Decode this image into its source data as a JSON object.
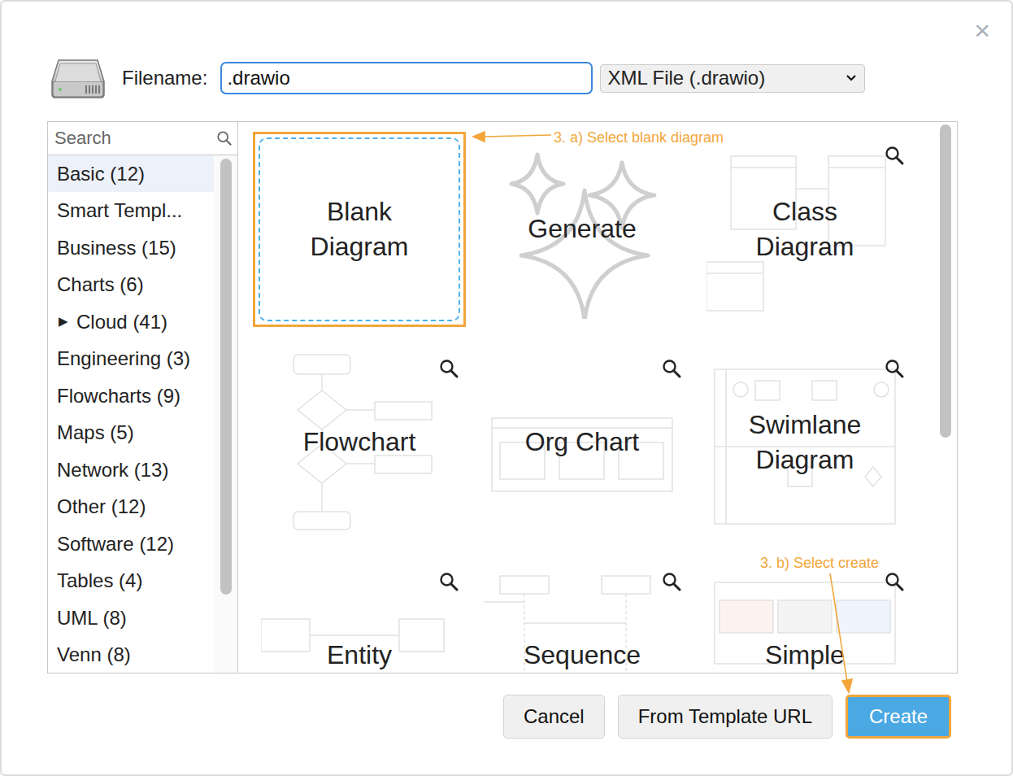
{
  "dialog": {
    "close": "×"
  },
  "filename": {
    "label": "Filename:",
    "value": ".drawio"
  },
  "format": {
    "value": "XML File (.drawio)"
  },
  "search": {
    "placeholder": "Search"
  },
  "categories": [
    {
      "label": "Basic (12)",
      "selected": true,
      "kind": "item"
    },
    {
      "label": "Smart Templ...",
      "selected": false,
      "kind": "item"
    },
    {
      "label": "Business (15)",
      "selected": false,
      "kind": "item"
    },
    {
      "label": "Charts (6)",
      "selected": false,
      "kind": "item"
    },
    {
      "label": "Cloud (41)",
      "selected": false,
      "kind": "group",
      "expander": "▶"
    },
    {
      "label": "Engineering (3)",
      "selected": false,
      "kind": "item"
    },
    {
      "label": "Flowcharts (9)",
      "selected": false,
      "kind": "item"
    },
    {
      "label": "Maps (5)",
      "selected": false,
      "kind": "item"
    },
    {
      "label": "Network (13)",
      "selected": false,
      "kind": "item"
    },
    {
      "label": "Other (12)",
      "selected": false,
      "kind": "item"
    },
    {
      "label": "Software (12)",
      "selected": false,
      "kind": "item"
    },
    {
      "label": "Tables (4)",
      "selected": false,
      "kind": "item"
    },
    {
      "label": "UML (8)",
      "selected": false,
      "kind": "item"
    },
    {
      "label": "Venn (8)",
      "selected": false,
      "kind": "item"
    }
  ],
  "templates": [
    {
      "label": "Blank Diagram",
      "selected": true,
      "kind": "blank",
      "preview": false
    },
    {
      "label": "Generate",
      "selected": false,
      "kind": "generate",
      "preview": false
    },
    {
      "label": "Class Diagram",
      "selected": false,
      "kind": "class",
      "preview": true
    },
    {
      "label": "Flowchart",
      "selected": false,
      "kind": "flowchart",
      "preview": true
    },
    {
      "label": "Org Chart",
      "selected": false,
      "kind": "org",
      "preview": true
    },
    {
      "label": "Swimlane Diagram",
      "selected": false,
      "kind": "swimlane",
      "preview": true
    },
    {
      "label": "Entity",
      "selected": false,
      "kind": "er",
      "preview": true
    },
    {
      "label": "Sequence",
      "selected": false,
      "kind": "sequence",
      "preview": true
    },
    {
      "label": "Simple",
      "selected": false,
      "kind": "kanban",
      "preview": true
    }
  ],
  "annotations": [
    {
      "text": "3. a) Select blank diagram"
    },
    {
      "text": "3. b) Select create"
    }
  ],
  "buttons": [
    {
      "label": "Cancel",
      "primary": false
    },
    {
      "label": "From Template URL",
      "primary": false
    },
    {
      "label": "Create",
      "primary": true
    }
  ]
}
